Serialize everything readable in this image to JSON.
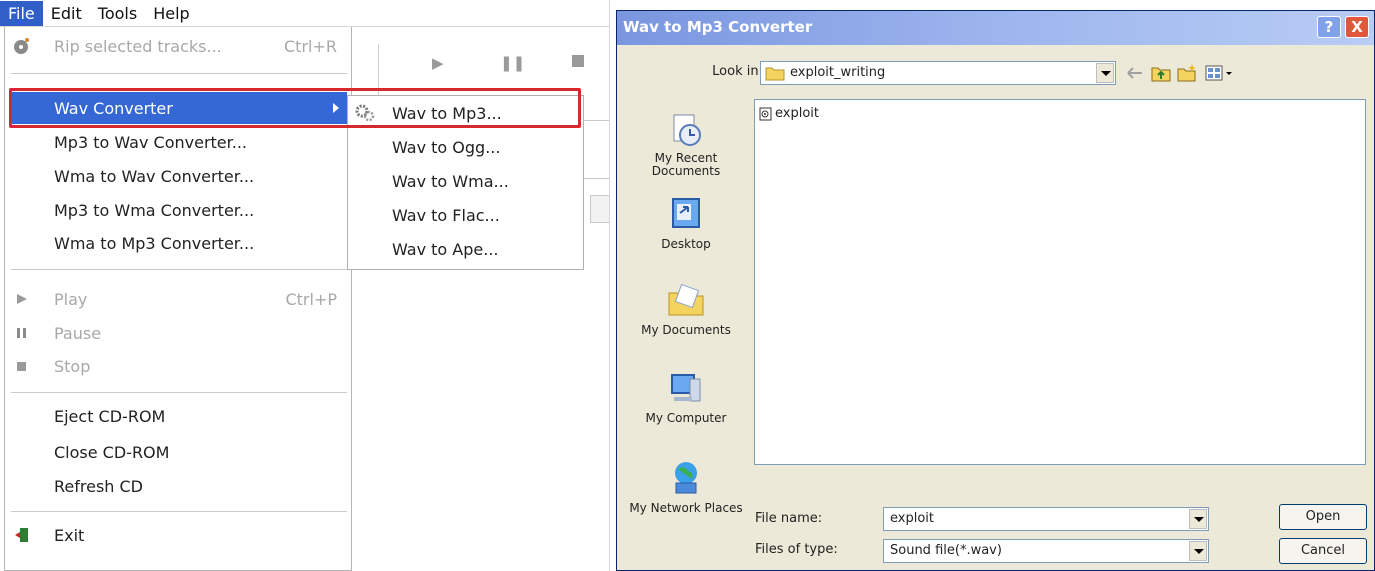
{
  "left_app": {
    "menubar": [
      "File",
      "Edit",
      "Tools",
      "Help"
    ],
    "file_menu": {
      "rip": {
        "label": "Rip selected tracks...",
        "shortcut": "Ctrl+R",
        "icon": "cd-icon"
      },
      "wav_converter": {
        "label": "Wav Converter"
      },
      "mp3_to_wav": {
        "label": "Mp3 to Wav Converter..."
      },
      "wma_to_wav": {
        "label": "Wma to Wav Converter..."
      },
      "mp3_to_wma": {
        "label": "Mp3 to Wma Converter..."
      },
      "wma_to_mp3": {
        "label": "Wma to Mp3 Converter..."
      },
      "play": {
        "label": "Play",
        "shortcut": "Ctrl+P",
        "icon": "play-icon"
      },
      "pause": {
        "label": "Pause",
        "icon": "pause-icon"
      },
      "stop": {
        "label": "Stop",
        "icon": "stop-icon"
      },
      "eject": {
        "label": "Eject CD-ROM"
      },
      "close": {
        "label": "Close CD-ROM"
      },
      "refresh": {
        "label": "Refresh CD"
      },
      "exit": {
        "label": "Exit",
        "icon": "exit-door-icon"
      }
    },
    "submenu": {
      "items": [
        "Wav to Mp3...",
        "Wav to Ogg...",
        "Wav to Wma...",
        "Wav to Flac...",
        "Wav to Ape..."
      ],
      "icon": "gears-icon"
    },
    "colors": {
      "highlight": "#3568d4",
      "annotation_box": "#d62a2a"
    }
  },
  "dialog": {
    "title": "Wav to Mp3 Converter",
    "help_button": "?",
    "close_button": "X",
    "look_in_label": "Look in:",
    "look_in_value": "exploit_writing",
    "places": [
      "My Recent Documents",
      "Desktop",
      "My Documents",
      "My Computer",
      "My Network Places"
    ],
    "files": [
      "exploit"
    ],
    "file_name_label": "File name:",
    "file_name_value": "exploit",
    "files_of_type_label": "Files of type:",
    "files_of_type_value": "Sound file(*.wav)",
    "open_button": "Open",
    "cancel_button": "Cancel"
  }
}
